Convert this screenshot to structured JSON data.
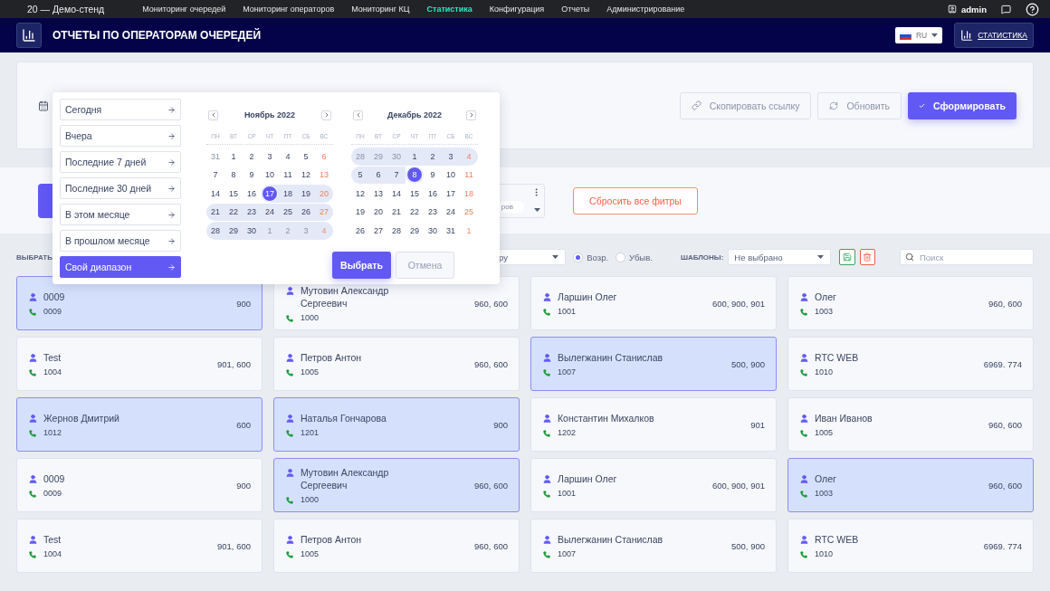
{
  "top_nav": {
    "brand": "20 — Демо-стенд",
    "items": [
      {
        "label": "Мониторинг очередей",
        "selected": false
      },
      {
        "label": "Мониторинг операторов",
        "selected": false
      },
      {
        "label": "Мониторинг КЦ",
        "selected": false
      },
      {
        "label": "Статистика",
        "selected": true
      },
      {
        "label": "Конфигурация",
        "selected": false
      },
      {
        "label": "Отчеты",
        "selected": false
      },
      {
        "label": "Администрирование",
        "selected": false
      }
    ],
    "user": "admin"
  },
  "header": {
    "title": "ОТЧЕТЫ ПО ОПЕРАТОРАМ ОЧЕРЕДЕЙ",
    "language": "RU",
    "section_button": "СТАТИСТИКА"
  },
  "report_panel": {
    "buttons": [
      {
        "label": "Скопировать ссылку",
        "kind": "link"
      },
      {
        "label": "Обновить",
        "kind": "refresh"
      },
      {
        "label": "Сформировать",
        "kind": "primary"
      }
    ]
  },
  "filters": {
    "chip": "ров",
    "reset_button": "Сбросить все фитры"
  },
  "toolbar": {
    "select_label": "ВЫБРАТЬ:",
    "sort_field": "ру",
    "sort_order": [
      {
        "label": "Возр.",
        "selected": true
      },
      {
        "label": "Убыв.",
        "selected": false
      }
    ],
    "templates_label": "ШАБЛОНЫ:",
    "template": "Не выбрано",
    "search": {
      "placeholder": "Поиск"
    }
  },
  "date_picker": {
    "presets": [
      {
        "label": "Сегодня",
        "selected": false
      },
      {
        "label": "Вчера",
        "selected": false
      },
      {
        "label": "Последние 7 дней",
        "selected": false
      },
      {
        "label": "Последние 30 дней",
        "selected": false
      },
      {
        "label": "В этом месяце",
        "selected": false
      },
      {
        "label": "В прошлом месяце",
        "selected": false
      },
      {
        "label": "Свой диапазон",
        "selected": true
      }
    ],
    "months": [
      {
        "title": "Ноябрь 2022",
        "weekdays": [
          "ПН",
          "ВТ",
          "СР",
          "ЧТ",
          "ПТ",
          "СБ",
          "ВС"
        ],
        "days": [
          {
            "day": "31",
            "outside": true,
            "in_range": false,
            "selected": false
          },
          {
            "day": "1",
            "outside": false,
            "in_range": false,
            "selected": false
          },
          {
            "day": "2",
            "outside": false,
            "in_range": false,
            "selected": false
          },
          {
            "day": "3",
            "outside": false,
            "in_range": false,
            "selected": false
          },
          {
            "day": "4",
            "outside": false,
            "in_range": false,
            "selected": false
          },
          {
            "day": "5",
            "outside": false,
            "in_range": false,
            "selected": false
          },
          {
            "day": "6",
            "outside": false,
            "in_range": false,
            "selected": false
          },
          {
            "day": "7",
            "outside": false,
            "in_range": false,
            "selected": false
          },
          {
            "day": "8",
            "outside": false,
            "in_range": false,
            "selected": false
          },
          {
            "day": "9",
            "outside": false,
            "in_range": false,
            "selected": false
          },
          {
            "day": "10",
            "outside": false,
            "in_range": false,
            "selected": false
          },
          {
            "day": "11",
            "outside": false,
            "in_range": false,
            "selected": false
          },
          {
            "day": "12",
            "outside": false,
            "in_range": false,
            "selected": false
          },
          {
            "day": "13",
            "outside": false,
            "in_range": false,
            "selected": false
          },
          {
            "day": "14",
            "outside": false,
            "in_range": false,
            "selected": false
          },
          {
            "day": "15",
            "outside": false,
            "in_range": false,
            "selected": false
          },
          {
            "day": "16",
            "outside": false,
            "in_range": false,
            "selected": false
          },
          {
            "day": "17",
            "outside": false,
            "in_range": true,
            "selected": true
          },
          {
            "day": "18",
            "outside": false,
            "in_range": true,
            "selected": false
          },
          {
            "day": "19",
            "outside": false,
            "in_range": true,
            "selected": false
          },
          {
            "day": "20",
            "outside": false,
            "in_range": true,
            "selected": false
          },
          {
            "day": "21",
            "outside": false,
            "in_range": true,
            "selected": false
          },
          {
            "day": "22",
            "outside": false,
            "in_range": true,
            "selected": false
          },
          {
            "day": "23",
            "outside": false,
            "in_range": true,
            "selected": false
          },
          {
            "day": "24",
            "outside": false,
            "in_range": true,
            "selected": false
          },
          {
            "day": "25",
            "outside": false,
            "in_range": true,
            "selected": false
          },
          {
            "day": "26",
            "outside": false,
            "in_range": true,
            "selected": false
          },
          {
            "day": "27",
            "outside": false,
            "in_range": true,
            "selected": false
          },
          {
            "day": "28",
            "outside": false,
            "in_range": true,
            "selected": false
          },
          {
            "day": "29",
            "outside": false,
            "in_range": true,
            "selected": false
          },
          {
            "day": "30",
            "outside": false,
            "in_range": true,
            "selected": false
          },
          {
            "day": "1",
            "outside": true,
            "in_range": true,
            "selected": false
          },
          {
            "day": "2",
            "outside": true,
            "in_range": true,
            "selected": false
          },
          {
            "day": "3",
            "outside": true,
            "in_range": true,
            "selected": false
          },
          {
            "day": "4",
            "outside": true,
            "in_range": true,
            "selected": false
          }
        ]
      },
      {
        "title": "Декабрь 2022",
        "weekdays": [
          "ПН",
          "ВТ",
          "СР",
          "ЧТ",
          "ПТ",
          "СБ",
          "ВС"
        ],
        "days": [
          {
            "day": "28",
            "outside": true,
            "in_range": true,
            "selected": false
          },
          {
            "day": "29",
            "outside": true,
            "in_range": true,
            "selected": false
          },
          {
            "day": "30",
            "outside": true,
            "in_range": true,
            "selected": false
          },
          {
            "day": "1",
            "outside": false,
            "in_range": true,
            "selected": false
          },
          {
            "day": "2",
            "outside": false,
            "in_range": true,
            "selected": false
          },
          {
            "day": "3",
            "outside": false,
            "in_range": true,
            "selected": false
          },
          {
            "day": "4",
            "outside": false,
            "in_range": true,
            "selected": false
          },
          {
            "day": "5",
            "outside": false,
            "in_range": true,
            "selected": false
          },
          {
            "day": "6",
            "outside": false,
            "in_range": true,
            "selected": false
          },
          {
            "day": "7",
            "outside": false,
            "in_range": true,
            "selected": false
          },
          {
            "day": "8",
            "outside": false,
            "in_range": true,
            "selected": true
          },
          {
            "day": "9",
            "outside": false,
            "in_range": false,
            "selected": false
          },
          {
            "day": "10",
            "outside": false,
            "in_range": false,
            "selected": false
          },
          {
            "day": "11",
            "outside": false,
            "in_range": false,
            "selected": false
          },
          {
            "day": "12",
            "outside": false,
            "in_range": false,
            "selected": false
          },
          {
            "day": "13",
            "outside": false,
            "in_range": false,
            "selected": false
          },
          {
            "day": "14",
            "outside": false,
            "in_range": false,
            "selected": false
          },
          {
            "day": "15",
            "outside": false,
            "in_range": false,
            "selected": false
          },
          {
            "day": "16",
            "outside": false,
            "in_range": false,
            "selected": false
          },
          {
            "day": "17",
            "outside": false,
            "in_range": false,
            "selected": false
          },
          {
            "day": "18",
            "outside": false,
            "in_range": false,
            "selected": false
          },
          {
            "day": "19",
            "outside": false,
            "in_range": false,
            "selected": false
          },
          {
            "day": "20",
            "outside": false,
            "in_range": false,
            "selected": false
          },
          {
            "day": "21",
            "outside": false,
            "in_range": false,
            "selected": false
          },
          {
            "day": "22",
            "outside": false,
            "in_range": false,
            "selected": false
          },
          {
            "day": "23",
            "outside": false,
            "in_range": false,
            "selected": false
          },
          {
            "day": "24",
            "outside": false,
            "in_range": false,
            "selected": false
          },
          {
            "day": "25",
            "outside": false,
            "in_range": false,
            "selected": false
          },
          {
            "day": "26",
            "outside": false,
            "in_range": false,
            "selected": false
          },
          {
            "day": "27",
            "outside": false,
            "in_range": false,
            "selected": false
          },
          {
            "day": "28",
            "outside": false,
            "in_range": false,
            "selected": false
          },
          {
            "day": "29",
            "outside": false,
            "in_range": false,
            "selected": false
          },
          {
            "day": "30",
            "outside": false,
            "in_range": false,
            "selected": false
          },
          {
            "day": "31",
            "outside": false,
            "in_range": false,
            "selected": false
          },
          {
            "day": "1",
            "outside": true,
            "in_range": false,
            "selected": false
          }
        ]
      }
    ],
    "buttons": [
      {
        "label": "Выбрать",
        "kind": "primary"
      },
      {
        "label": "Отмена",
        "kind": "secondary"
      }
    ]
  },
  "operators": [
    {
      "name": "0009",
      "phone": "0009",
      "queues": "900",
      "selected": true
    },
    {
      "name": "Мутовин Александр Сергеевич",
      "phone": "1000",
      "queues": "960, 600",
      "selected": false
    },
    {
      "name": "Ларшин Олег",
      "phone": "1001",
      "queues": "600, 900, 901",
      "selected": false
    },
    {
      "name": "Олег",
      "phone": "1003",
      "queues": "960, 600",
      "selected": false
    },
    {
      "name": "Test",
      "phone": "1004",
      "queues": "901, 600",
      "selected": false
    },
    {
      "name": "Петров Антон",
      "phone": "1005",
      "queues": "960, 600",
      "selected": false
    },
    {
      "name": "Вылегжанин Станислав",
      "phone": "1007",
      "queues": "500, 900",
      "selected": true
    },
    {
      "name": "RTC WEB",
      "phone": "1010",
      "queues": "6969. 774",
      "selected": false
    },
    {
      "name": "Жернов Дмитрий",
      "phone": "1012",
      "queues": "600",
      "selected": true
    },
    {
      "name": "Наталья Гончарова",
      "phone": "1201",
      "queues": "900",
      "selected": true
    },
    {
      "name": "Константин Михалков",
      "phone": "1202",
      "queues": "901",
      "selected": false
    },
    {
      "name": "Иван Иванов",
      "phone": "1005",
      "queues": "960, 600",
      "selected": false
    },
    {
      "name": "0009",
      "phone": "0009",
      "queues": "900",
      "selected": false
    },
    {
      "name": "Мутовин Александр Сергеевич",
      "phone": "1000",
      "queues": "960, 600",
      "selected": true
    },
    {
      "name": "Ларшин Олег",
      "phone": "1001",
      "queues": "600, 900, 901",
      "selected": false
    },
    {
      "name": "Олег",
      "phone": "1003",
      "queues": "960, 600",
      "selected": true
    },
    {
      "name": "Test",
      "phone": "1004",
      "queues": "901, 600",
      "selected": false
    },
    {
      "name": "Петров Антон",
      "phone": "1005",
      "queues": "960, 600",
      "selected": false
    },
    {
      "name": "Вылегжанин Станислав",
      "phone": "1007",
      "queues": "500, 900",
      "selected": false
    },
    {
      "name": "RTC WEB",
      "phone": "1010",
      "queues": "6969. 774",
      "selected": false
    }
  ]
}
